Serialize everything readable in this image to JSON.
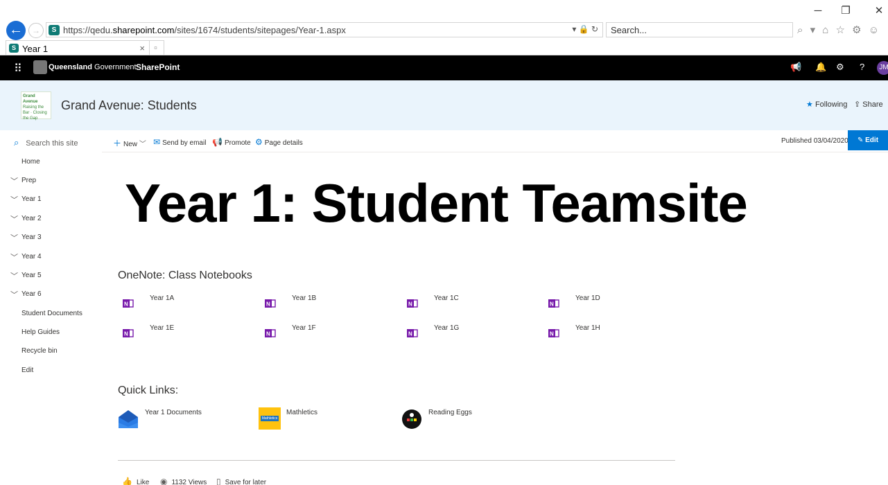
{
  "browser": {
    "url_prefix": "https://qedu.",
    "url_domain": "sharepoint.com",
    "url_path": "/sites/1674/students/sitepages/Year-1.aspx",
    "search_placeholder": "Search...",
    "tab_title": "Year 1",
    "address_icons": "▾ 🔒 ↻",
    "search_icons": "⌕ ▾",
    "toolbar_icons": "⌂ ☆ ⚙ ☺"
  },
  "suitebar": {
    "org_bold": "Queensland",
    "org_rest": " Government",
    "app": "SharePoint",
    "avatar": "JM"
  },
  "site": {
    "logo_text_1": "Grand Avenue",
    "logo_text_2": "Raising the Bar · Closing the Gap",
    "title": "Grand Avenue: Students",
    "follow": "Following",
    "share": "Share"
  },
  "nav": {
    "search": "Search this site",
    "items": [
      {
        "label": "Home",
        "expandable": false
      },
      {
        "label": "Prep",
        "expandable": true
      },
      {
        "label": "Year 1",
        "expandable": true
      },
      {
        "label": "Year 2",
        "expandable": true
      },
      {
        "label": "Year 3",
        "expandable": true
      },
      {
        "label": "Year 4",
        "expandable": true
      },
      {
        "label": "Year 5",
        "expandable": true
      },
      {
        "label": "Year 6",
        "expandable": true
      },
      {
        "label": "Student Documents",
        "expandable": false
      },
      {
        "label": "Help Guides",
        "expandable": false
      },
      {
        "label": "Recycle bin",
        "expandable": false
      },
      {
        "label": "Edit",
        "expandable": false
      }
    ]
  },
  "commandbar": {
    "new": "New",
    "send": "Send by email",
    "promote": "Promote",
    "details": "Page details",
    "published": "Published 03/04/2020",
    "edit": "Edit"
  },
  "page": {
    "hero": "Year 1: Student Teamsite",
    "notebooks_title": "OneNote: Class Notebooks",
    "notebooks": [
      "Year 1A",
      "Year 1B",
      "Year 1C",
      "Year 1D",
      "Year 1E",
      "Year 1F",
      "Year 1G",
      "Year 1H"
    ],
    "quicklinks_title": "Quick Links:",
    "quicklinks": [
      "Year 1 Documents",
      "Mathletics",
      "Reading Eggs"
    ],
    "mathletics_logo": "Mathletics",
    "social": {
      "like": "Like",
      "views": "1132 Views",
      "save": "Save for later"
    }
  }
}
